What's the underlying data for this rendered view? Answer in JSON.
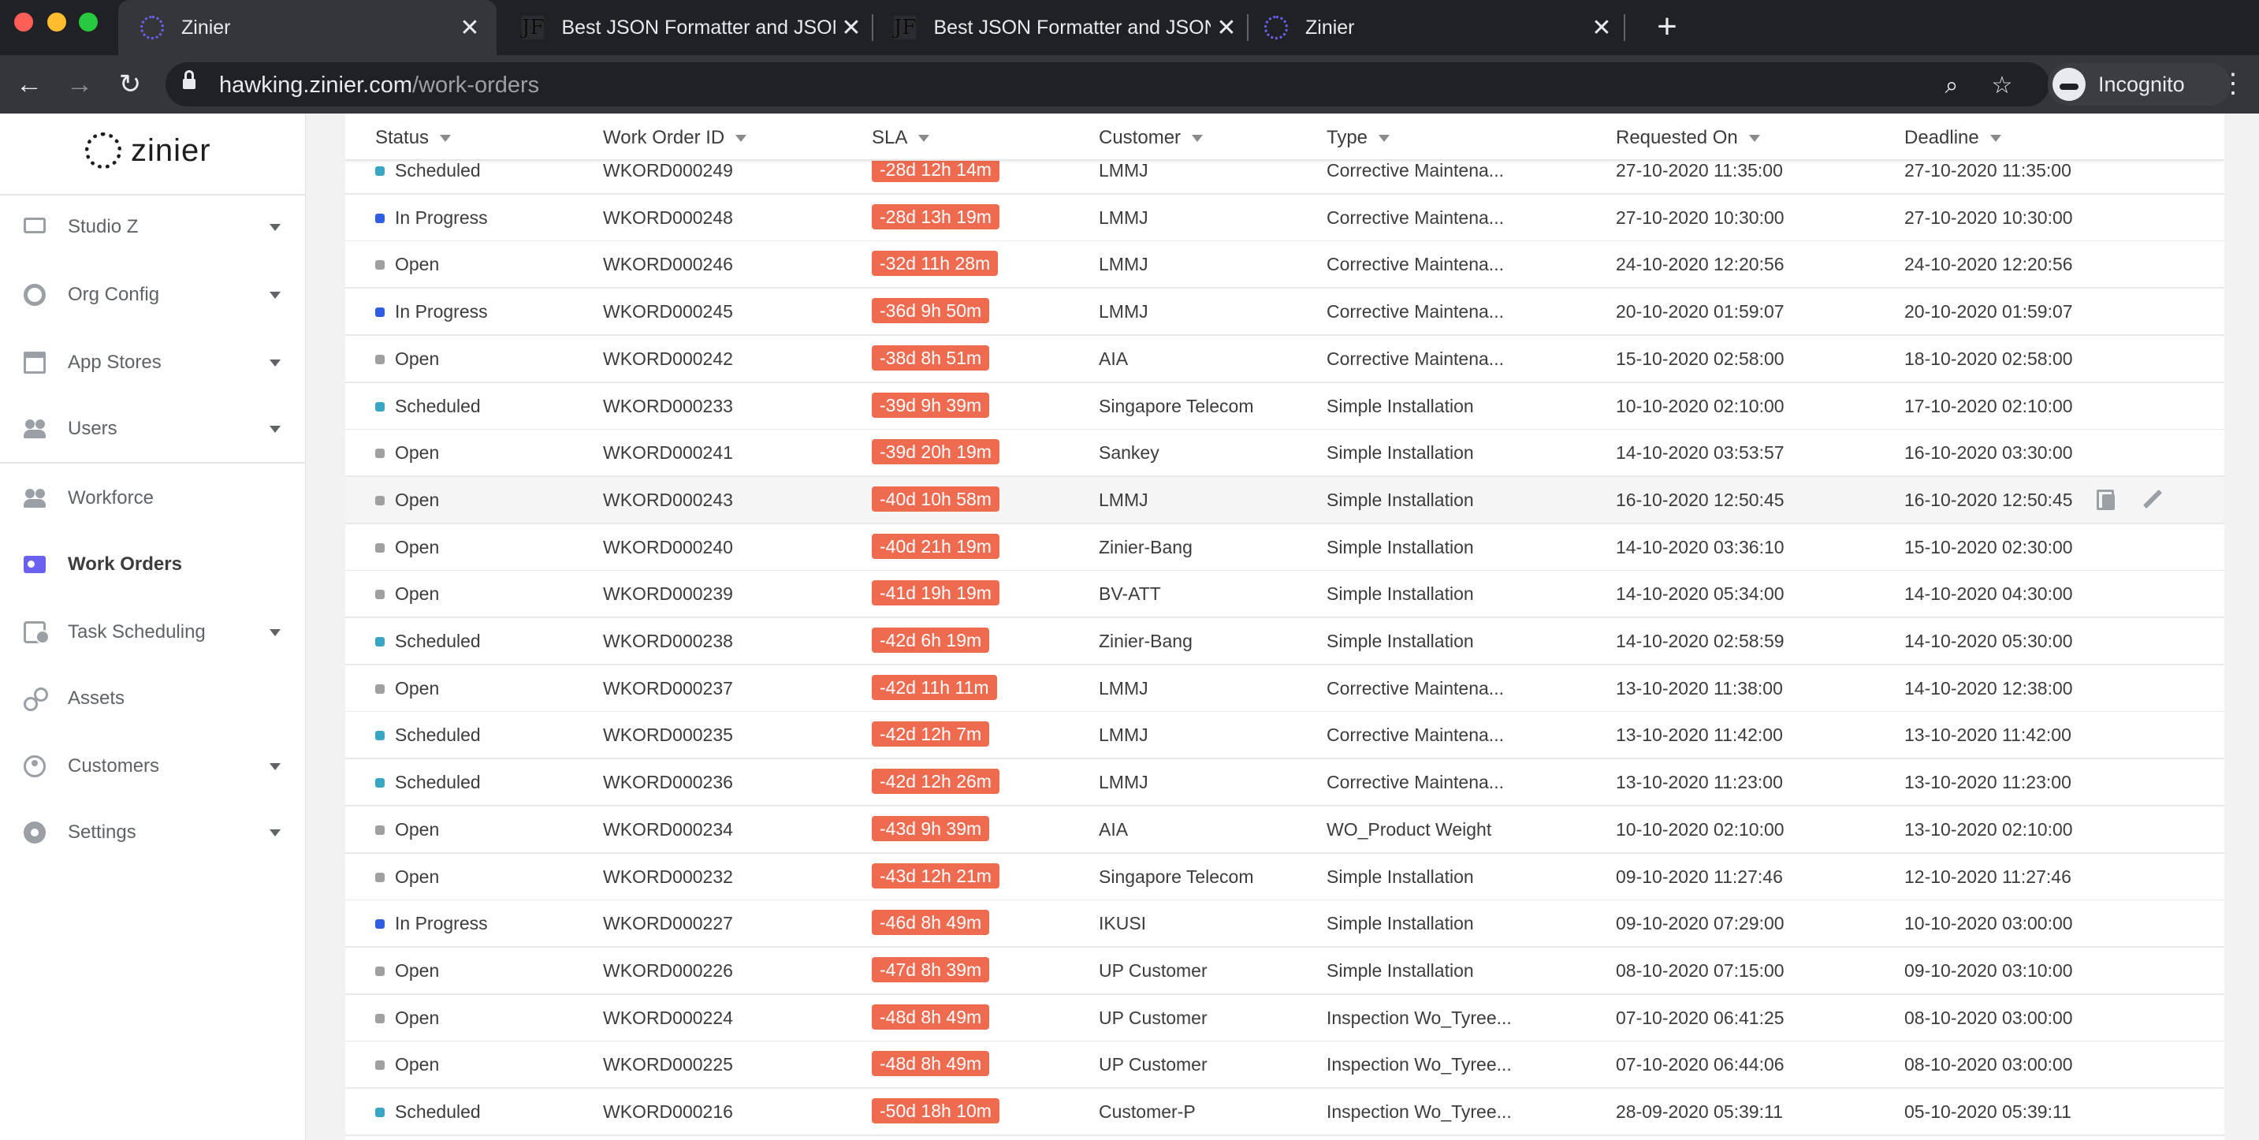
{
  "browser": {
    "tabs": [
      {
        "title": "Zinier",
        "favicon": "zinier-spinner-icon",
        "active": true
      },
      {
        "title": "Best JSON Formatter and JSON",
        "favicon": "jf-icon",
        "active": false
      },
      {
        "title": "Best JSON Formatter and JSON",
        "favicon": "jf-icon",
        "active": false
      },
      {
        "title": "Zinier",
        "favicon": "zinier-spinner-icon",
        "active": false
      }
    ],
    "url_host": "hawking.zinier.com",
    "url_path": "/work-orders",
    "profile_label": "Incognito",
    "close_glyph": "✕",
    "new_tab_glyph": "+",
    "back_glyph": "←",
    "forward_glyph": "→",
    "reload_glyph": "↻",
    "search_glyph": "⌕",
    "star_glyph": "☆",
    "menu_glyph": "⋮"
  },
  "sidebar": {
    "logo_text": "zinier",
    "items": [
      {
        "label": "Studio Z",
        "icon": "monitor-icon",
        "has_caret": true
      },
      {
        "label": "Org Config",
        "icon": "org-config-icon",
        "has_caret": true
      },
      {
        "label": "App Stores",
        "icon": "store-icon",
        "has_caret": true
      },
      {
        "label": "Users",
        "icon": "users-icon",
        "has_caret": true
      },
      {
        "label": "Workforce",
        "icon": "workforce-icon",
        "has_caret": false
      },
      {
        "label": "Work Orders",
        "icon": "work-orders-icon",
        "has_caret": false,
        "active": true
      },
      {
        "label": "Task Scheduling",
        "icon": "task-scheduling-icon",
        "has_caret": true
      },
      {
        "label": "Assets",
        "icon": "assets-icon",
        "has_caret": false
      },
      {
        "label": "Customers",
        "icon": "customers-icon",
        "has_caret": true
      },
      {
        "label": "Settings",
        "icon": "settings-icon",
        "has_caret": true
      }
    ]
  },
  "colors": {
    "accent": "#6b61f0",
    "sla_badge": "#ef6b50",
    "status_scheduled": "#3aa6c4",
    "status_in_progress": "#2f5fe0",
    "status_open": "#a0a0a0"
  },
  "table": {
    "columns": [
      "Status",
      "Work Order ID",
      "SLA",
      "Customer",
      "Type",
      "Requested On",
      "Deadline"
    ],
    "rows": [
      {
        "status": "Scheduled",
        "id": "WKORD000249",
        "sla": "-28d 12h 14m",
        "customer": "LMMJ",
        "type": "Corrective Maintena...",
        "requested": "27-10-2020 11:35:00",
        "deadline": "27-10-2020 11:35:00"
      },
      {
        "status": "In Progress",
        "id": "WKORD000248",
        "sla": "-28d 13h 19m",
        "customer": "LMMJ",
        "type": "Corrective Maintena...",
        "requested": "27-10-2020 10:30:00",
        "deadline": "27-10-2020 10:30:00"
      },
      {
        "status": "Open",
        "id": "WKORD000246",
        "sla": "-32d 11h 28m",
        "customer": "LMMJ",
        "type": "Corrective Maintena...",
        "requested": "24-10-2020 12:20:56",
        "deadline": "24-10-2020 12:20:56"
      },
      {
        "status": "In Progress",
        "id": "WKORD000245",
        "sla": "-36d 9h 50m",
        "customer": "LMMJ",
        "type": "Corrective Maintena...",
        "requested": "20-10-2020 01:59:07",
        "deadline": "20-10-2020 01:59:07"
      },
      {
        "status": "Open",
        "id": "WKORD000242",
        "sla": "-38d 8h 51m",
        "customer": "AIA",
        "type": "Corrective Maintena...",
        "requested": "15-10-2020 02:58:00",
        "deadline": "18-10-2020 02:58:00"
      },
      {
        "status": "Scheduled",
        "id": "WKORD000233",
        "sla": "-39d 9h 39m",
        "customer": "Singapore Telecom",
        "type": "Simple Installation",
        "requested": "10-10-2020 02:10:00",
        "deadline": "17-10-2020 02:10:00"
      },
      {
        "status": "Open",
        "id": "WKORD000241",
        "sla": "-39d 20h 19m",
        "customer": "Sankey",
        "type": "Simple Installation",
        "requested": "14-10-2020 03:53:57",
        "deadline": "16-10-2020 03:30:00"
      },
      {
        "status": "Open",
        "id": "WKORD000243",
        "sla": "-40d 10h 58m",
        "customer": "LMMJ",
        "type": "Simple Installation",
        "requested": "16-10-2020 12:50:45",
        "deadline": "16-10-2020 12:50:45",
        "hover": true
      },
      {
        "status": "Open",
        "id": "WKORD000240",
        "sla": "-40d 21h 19m",
        "customer": "Zinier-Bang",
        "type": "Simple Installation",
        "requested": "14-10-2020 03:36:10",
        "deadline": "15-10-2020 02:30:00"
      },
      {
        "status": "Open",
        "id": "WKORD000239",
        "sla": "-41d 19h 19m",
        "customer": "BV-ATT",
        "type": "Simple Installation",
        "requested": "14-10-2020 05:34:00",
        "deadline": "14-10-2020 04:30:00"
      },
      {
        "status": "Scheduled",
        "id": "WKORD000238",
        "sla": "-42d 6h 19m",
        "customer": "Zinier-Bang",
        "type": "Simple Installation",
        "requested": "14-10-2020 02:58:59",
        "deadline": "14-10-2020 05:30:00"
      },
      {
        "status": "Open",
        "id": "WKORD000237",
        "sla": "-42d 11h 11m",
        "customer": "LMMJ",
        "type": "Corrective Maintena...",
        "requested": "13-10-2020 11:38:00",
        "deadline": "14-10-2020 12:38:00"
      },
      {
        "status": "Scheduled",
        "id": "WKORD000235",
        "sla": "-42d 12h 7m",
        "customer": "LMMJ",
        "type": "Corrective Maintena...",
        "requested": "13-10-2020 11:42:00",
        "deadline": "13-10-2020 11:42:00"
      },
      {
        "status": "Scheduled",
        "id": "WKORD000236",
        "sla": "-42d 12h 26m",
        "customer": "LMMJ",
        "type": "Corrective Maintena...",
        "requested": "13-10-2020 11:23:00",
        "deadline": "13-10-2020 11:23:00"
      },
      {
        "status": "Open",
        "id": "WKORD000234",
        "sla": "-43d 9h 39m",
        "customer": "AIA",
        "type": "WO_Product Weight",
        "requested": "10-10-2020 02:10:00",
        "deadline": "13-10-2020 02:10:00"
      },
      {
        "status": "Open",
        "id": "WKORD000232",
        "sla": "-43d 12h 21m",
        "customer": "Singapore Telecom",
        "type": "Simple Installation",
        "requested": "09-10-2020 11:27:46",
        "deadline": "12-10-2020 11:27:46"
      },
      {
        "status": "In Progress",
        "id": "WKORD000227",
        "sla": "-46d 8h 49m",
        "customer": "IKUSI",
        "type": "Simple Installation",
        "requested": "09-10-2020 07:29:00",
        "deadline": "10-10-2020 03:00:00"
      },
      {
        "status": "Open",
        "id": "WKORD000226",
        "sla": "-47d 8h 39m",
        "customer": "UP Customer",
        "type": "Simple Installation",
        "requested": "08-10-2020 07:15:00",
        "deadline": "09-10-2020 03:10:00"
      },
      {
        "status": "Open",
        "id": "WKORD000224",
        "sla": "-48d 8h 49m",
        "customer": "UP Customer",
        "type": "Inspection Wo_Tyree...",
        "requested": "07-10-2020 06:41:25",
        "deadline": "08-10-2020 03:00:00"
      },
      {
        "status": "Open",
        "id": "WKORD000225",
        "sla": "-48d 8h 49m",
        "customer": "UP Customer",
        "type": "Inspection Wo_Tyree...",
        "requested": "07-10-2020 06:44:06",
        "deadline": "08-10-2020 03:00:00"
      },
      {
        "status": "Scheduled",
        "id": "WKORD000216",
        "sla": "-50d 18h 10m",
        "customer": "Customer-P",
        "type": "Inspection Wo_Tyree...",
        "requested": "28-09-2020 05:39:11",
        "deadline": "05-10-2020 05:39:11"
      }
    ]
  }
}
